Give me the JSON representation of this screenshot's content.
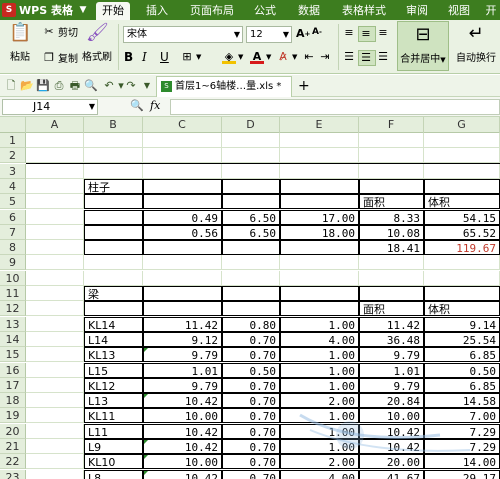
{
  "app": {
    "logo_text": "WPS 表格",
    "logo_mark": "S"
  },
  "menu": {
    "tabs": [
      "开始",
      "插入",
      "页面布局",
      "公式",
      "数据",
      "表格样式",
      "审阅",
      "视图",
      "开"
    ]
  },
  "ribbon": {
    "paste": "粘贴",
    "cut": "剪切",
    "copy": "复制",
    "format_painter": "格式刷",
    "font_name": "宋体",
    "font_size": "12",
    "merge_center": "合并居中",
    "wrap_text": "自动换行",
    "bold": "B",
    "italic": "I",
    "underline": "U"
  },
  "doc_tab": {
    "name": "首层1~6轴楼…量.xls *"
  },
  "formula_bar": {
    "cell_ref": "J14",
    "fx": "fx"
  },
  "columns": [
    "A",
    "B",
    "C",
    "D",
    "E",
    "F",
    "G"
  ],
  "rows": [
    {
      "n": "1",
      "cells": [
        "",
        "",
        "",
        "",
        "",
        "",
        ""
      ]
    },
    {
      "n": "2",
      "cells": [
        "",
        "",
        "",
        "",
        "",
        "",
        ""
      ]
    },
    {
      "n": "3",
      "cells": [
        "",
        "",
        "",
        "",
        "",
        "",
        ""
      ]
    },
    {
      "n": "4",
      "cells": [
        "",
        "柱子",
        "",
        "",
        "",
        "",
        ""
      ]
    },
    {
      "n": "5",
      "cells": [
        "",
        "",
        "",
        "",
        "",
        "面积",
        "体积"
      ]
    },
    {
      "n": "6",
      "cells": [
        "",
        "",
        "0.49",
        "6.50",
        "17.00",
        "8.33",
        "54.15"
      ]
    },
    {
      "n": "7",
      "cells": [
        "",
        "",
        "0.56",
        "6.50",
        "18.00",
        "10.08",
        "65.52"
      ]
    },
    {
      "n": "8",
      "cells": [
        "",
        "",
        "",
        "",
        "",
        "18.41",
        "119.67"
      ]
    },
    {
      "n": "9",
      "cells": [
        "",
        "",
        "",
        "",
        "",
        "",
        ""
      ]
    },
    {
      "n": "10",
      "cells": [
        "",
        "",
        "",
        "",
        "",
        "",
        ""
      ]
    },
    {
      "n": "11",
      "cells": [
        "",
        "梁",
        "",
        "",
        "",
        "",
        ""
      ]
    },
    {
      "n": "12",
      "cells": [
        "",
        "",
        "",
        "",
        "",
        "面积",
        "体积"
      ]
    },
    {
      "n": "13",
      "cells": [
        "",
        "KL14",
        "11.42",
        "0.80",
        "1.00",
        "11.42",
        "9.14"
      ]
    },
    {
      "n": "14",
      "cells": [
        "",
        "L14",
        "9.12",
        "0.70",
        "4.00",
        "36.48",
        "25.54"
      ]
    },
    {
      "n": "15",
      "cells": [
        "",
        "KL13",
        "9.79",
        "0.70",
        "1.00",
        "9.79",
        "6.85"
      ]
    },
    {
      "n": "16",
      "cells": [
        "",
        "L15",
        "1.01",
        "0.50",
        "1.00",
        "1.01",
        "0.50"
      ]
    },
    {
      "n": "17",
      "cells": [
        "",
        "KL12",
        "9.79",
        "0.70",
        "1.00",
        "9.79",
        "6.85"
      ]
    },
    {
      "n": "18",
      "cells": [
        "",
        "L13",
        "10.42",
        "0.70",
        "2.00",
        "20.84",
        "14.58"
      ]
    },
    {
      "n": "19",
      "cells": [
        "",
        "KL11",
        "10.00",
        "0.70",
        "1.00",
        "10.00",
        "7.00"
      ]
    },
    {
      "n": "20",
      "cells": [
        "",
        "L11",
        "10.42",
        "0.70",
        "1.00",
        "10.42",
        "7.29"
      ]
    },
    {
      "n": "21",
      "cells": [
        "",
        "L9",
        "10.42",
        "0.70",
        "1.00",
        "10.42",
        "7.29"
      ]
    },
    {
      "n": "22",
      "cells": [
        "",
        "KL10",
        "10.00",
        "0.70",
        "2.00",
        "20.00",
        "14.00"
      ]
    },
    {
      "n": "23",
      "cells": [
        "",
        "L8",
        "10.42",
        "0.70",
        "4.00",
        "41.67",
        "29.17"
      ]
    }
  ],
  "colors": {
    "brand": "#3d7d1f",
    "highlight_value": "#c0392b"
  }
}
